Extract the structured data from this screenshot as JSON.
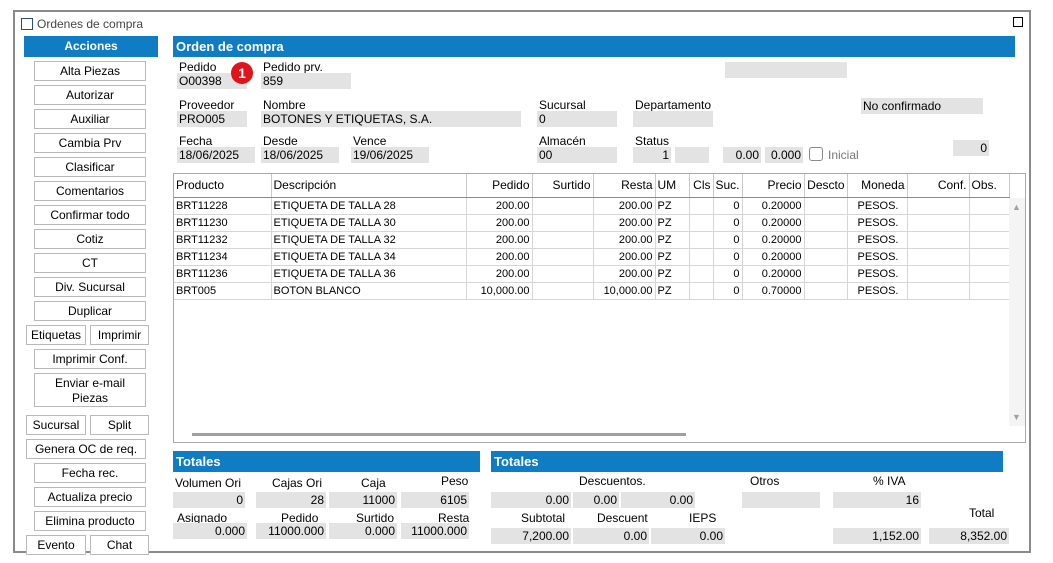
{
  "window": {
    "title": "Ordenes de compra"
  },
  "actions": {
    "header": "Acciones",
    "buttons": {
      "alta_piezas": "Alta Piezas",
      "autorizar": "Autorizar",
      "auxiliar": "Auxiliar",
      "cambia_prv": "Cambia Prv",
      "clasificar": "Clasificar",
      "comentarios": "Comentarios",
      "confirmar_todo": "Confirmar todo",
      "cotiz": "Cotiz",
      "ct": "CT",
      "div_sucursal": "Div. Sucursal",
      "duplicar": "Duplicar",
      "etiquetas": "Etiquetas",
      "imprimir": "Imprimir",
      "imprimir_conf": "Imprimir Conf.",
      "enviar_email": "Enviar e-mail",
      "piezas": "Piezas",
      "sucursal": "Sucursal",
      "split": "Split",
      "genera_oc": "Genera OC de req.",
      "fecha_rec": "Fecha rec.",
      "actualiza_precio": "Actualiza precio",
      "elimina_producto": "Elimina producto",
      "evento": "Evento",
      "chat": "Chat"
    }
  },
  "order": {
    "section_title": "Orden de compra",
    "badge": "1",
    "pedido_label": "Pedido",
    "pedido_value": "O00398",
    "pedido_prv_label": "Pedido prv.",
    "pedido_prv_value": "859",
    "proveedor_label": "Proveedor",
    "proveedor_value": "PRO005",
    "nombre_label": "Nombre",
    "nombre_value": "BOTONES Y ETIQUETAS, S.A.",
    "sucursal_label": "Sucursal",
    "sucursal_value": "0",
    "departamento_label": "Departamento",
    "departamento_value": "",
    "estado": "No confirmado",
    "fecha_label": "Fecha",
    "fecha_value": "18/06/2025",
    "desde_label": "Desde",
    "desde_value": "18/06/2025",
    "vence_label": "Vence",
    "vence_value": "19/06/2025",
    "almacen_label": "Almacén",
    "almacen_value": "00",
    "status_label": "Status",
    "status_value": "1",
    "val_a": "0.00",
    "val_b": "0.000",
    "inicial_label": "Inicial",
    "count_value": "0"
  },
  "grid": {
    "columns": [
      "Producto",
      "Descripción",
      "Pedido",
      "Surtido",
      "Resta",
      "UM",
      "Cls",
      "Suc.",
      "Precio",
      "Descto",
      "Moneda",
      "Conf.",
      "Obs."
    ],
    "rows": [
      [
        "BRT11228",
        "ETIQUETA DE TALLA 28",
        "200.00",
        "",
        "200.00",
        "PZ",
        "",
        "0",
        "0.20000",
        "",
        "PESOS.",
        "",
        ""
      ],
      [
        "BRT11230",
        "ETIQUETA DE TALLA 30",
        "200.00",
        "",
        "200.00",
        "PZ",
        "",
        "0",
        "0.20000",
        "",
        "PESOS.",
        "",
        ""
      ],
      [
        "BRT11232",
        "ETIQUETA DE TALLA 32",
        "200.00",
        "",
        "200.00",
        "PZ",
        "",
        "0",
        "0.20000",
        "",
        "PESOS.",
        "",
        ""
      ],
      [
        "BRT11234",
        "ETIQUETA DE TALLA 34",
        "200.00",
        "",
        "200.00",
        "PZ",
        "",
        "0",
        "0.20000",
        "",
        "PESOS.",
        "",
        ""
      ],
      [
        "BRT11236",
        "ETIQUETA DE TALLA 36",
        "200.00",
        "",
        "200.00",
        "PZ",
        "",
        "0",
        "0.20000",
        "",
        "PESOS.",
        "",
        ""
      ],
      [
        "BRT005",
        "BOTON BLANCO",
        "10,000.00",
        "",
        "10,000.00",
        "PZ",
        "",
        "0",
        "0.70000",
        "",
        "PESOS.",
        "",
        ""
      ]
    ]
  },
  "totales_left": {
    "title": "Totales",
    "volumen_ori_label": "Volumen Ori",
    "volumen_ori_value": "0",
    "cajas_ori_label": "Cajas Ori",
    "cajas_ori_value": "28",
    "caja_label": "Caja",
    "caja_value": "11000",
    "peso_label": "Peso",
    "peso_value": "6105",
    "asignado_label": "Asignado",
    "asignado_value": "0.000",
    "pedido_label": "Pedido",
    "pedido_value": "11000.000",
    "surtido_label": "Surtido",
    "surtido_value": "0.000",
    "resta_label": "Resta",
    "resta_value": "11000.000"
  },
  "totales_right": {
    "title": "Totales",
    "descuentos_label": "Descuentos.",
    "desc1_value": "0.00",
    "desc2_value": "0.00",
    "desc3_value": "0.00",
    "otros_label": "Otros",
    "otros_value": "",
    "iva_label": "% IVA",
    "iva_value": "16",
    "subtotal_label": "Subtotal",
    "subtotal_value": "7,200.00",
    "descuent_label": "Descuent",
    "descuent_value": "0.00",
    "ieps_label": "IEPS",
    "ieps_value": "0.00",
    "iva_amount": "1,152.00",
    "total_label": "Total",
    "total_value": "8,352.00"
  }
}
